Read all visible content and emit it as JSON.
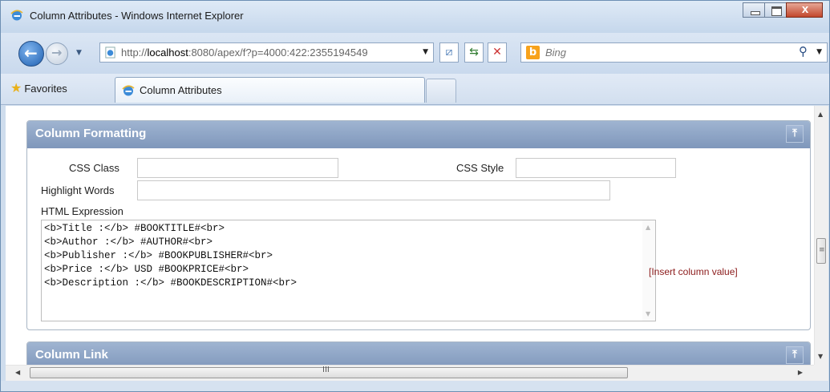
{
  "window": {
    "title": "Column Attributes - Windows Internet Explorer"
  },
  "toolbar": {
    "url_prefix": "http://",
    "url_host": "localhost",
    "url_rest": ":8080/apex/f?p=4000:422:2355194549",
    "search_placeholder": "Bing"
  },
  "favorites": {
    "label": "Favorites"
  },
  "tab": {
    "label": "Column Attributes"
  },
  "regions": {
    "formatting": {
      "title": "Column Formatting",
      "css_class_label": "CSS Class",
      "css_class_value": "",
      "css_style_label": "CSS Style",
      "css_style_value": "",
      "highlight_label": "Highlight Words",
      "highlight_value": "",
      "html_expr_label": "HTML Expression",
      "html_expr_value": "<b>Title :</b> #BOOKTITLE#<br>\n<b>Author :</b> #AUTHOR#<br>\n<b>Publisher :</b> #BOOKPUBLISHER#<br>\n<b>Price :</b> USD #BOOKPRICE#<br>\n<b>Description :</b> #BOOKDESCRIPTION#<br>",
      "insert_link": "[Insert column value]"
    },
    "link": {
      "title": "Column Link"
    }
  },
  "hscroll": {
    "grip": "III"
  },
  "colors": {
    "region_header": "#7f97bb",
    "link_red": "#8b1a1a",
    "close_red": "#c2472c"
  }
}
